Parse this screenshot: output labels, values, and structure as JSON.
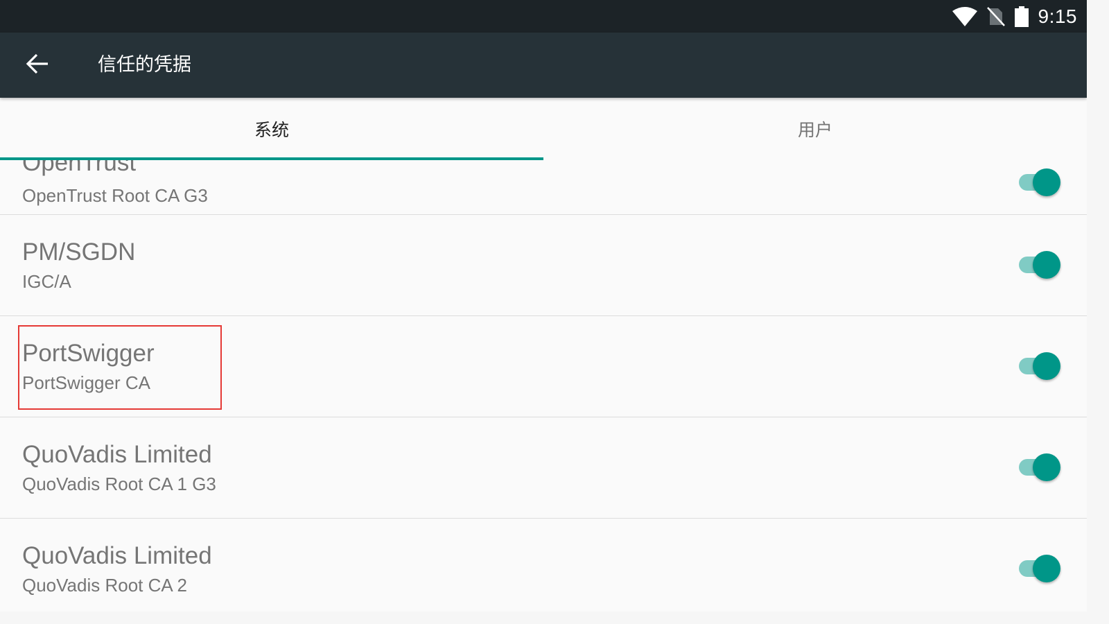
{
  "status_bar": {
    "time": "9:15",
    "icons": [
      "wifi-icon",
      "no-sim-icon",
      "battery-icon"
    ]
  },
  "toolbar": {
    "back_icon": "arrow-back-icon",
    "title": "信任的凭据"
  },
  "tabs": [
    {
      "label": "系统",
      "active": true
    },
    {
      "label": "用户",
      "active": false
    }
  ],
  "certificates": [
    {
      "org": "OpenTrust",
      "name": "OpenTrust Root CA G3",
      "enabled": true
    },
    {
      "org": "PM/SGDN",
      "name": "IGC/A",
      "enabled": true
    },
    {
      "org": "PortSwigger",
      "name": "PortSwigger CA",
      "enabled": true,
      "highlighted": true
    },
    {
      "org": "QuoVadis Limited",
      "name": "QuoVadis Root CA 1 G3",
      "enabled": true
    },
    {
      "org": "QuoVadis Limited",
      "name": "QuoVadis Root CA 2",
      "enabled": true
    }
  ],
  "colors": {
    "accent": "#009688",
    "accent_light": "#80cbc4",
    "toolbar": "#263238",
    "status_bar": "#1c2327",
    "highlight": "#e53935"
  }
}
